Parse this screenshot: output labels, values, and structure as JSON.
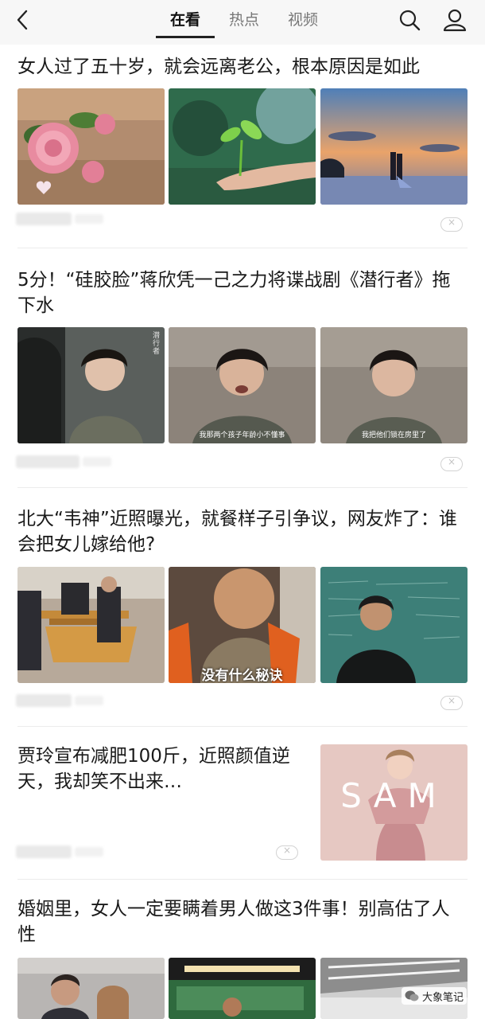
{
  "header": {
    "tabs": [
      {
        "label": "在看",
        "active": true
      },
      {
        "label": "热点",
        "active": false
      },
      {
        "label": "视频",
        "active": false
      }
    ]
  },
  "articles": [
    {
      "title": "女人过了五十岁，就会远离老公，根本原因是如此",
      "image_descriptions": [
        "pink rose with heart",
        "sprout in hand",
        "couple at sunset on water"
      ]
    },
    {
      "title": "5分！“硅胶脸”蒋欣凭一己之力将谍战剧《潜行者》拖下水",
      "captions": [
        "",
        "我那两个孩子年龄小不懂事",
        "我把他们锁在房里了"
      ],
      "poster_text": "潜行者"
    },
    {
      "title": "北大“韦神”近照曝光，就餐样子引争议，网友炸了：谁会把女儿嫁给他?",
      "captions": [
        "",
        "没有什么秘诀",
        ""
      ]
    },
    {
      "title": "贾玲宣布减肥100斤，近照颜值逆天，我却笑不出来…",
      "single_image_text": "SAM"
    },
    {
      "title": "婚姻里，女人一定要瞒着男人做这3件事！别高估了人性"
    }
  ],
  "dismiss_symbol": "×",
  "watermark": {
    "text": "大象笔记"
  },
  "colors": {
    "header_bg": "#f7f7f7",
    "tab_active": "#111111",
    "tab_inactive": "#777777",
    "divider": "#ececec"
  }
}
